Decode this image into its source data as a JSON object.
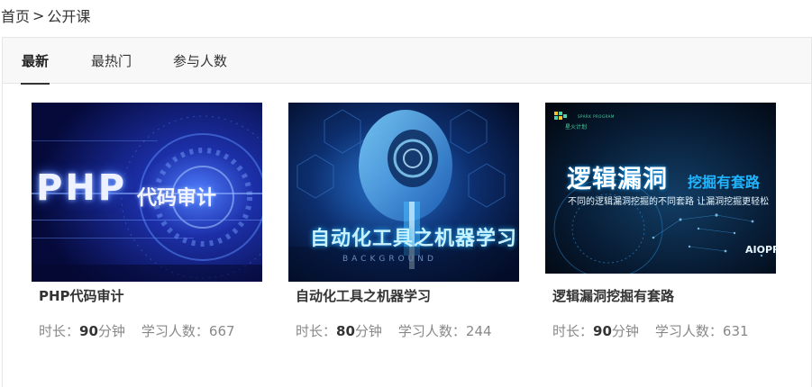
{
  "breadcrumb": {
    "home": "首页",
    "separator": ">",
    "current": "公开课"
  },
  "tabs": [
    {
      "label": "最新",
      "active": true
    },
    {
      "label": "最热门",
      "active": false
    },
    {
      "label": "参与人数",
      "active": false
    }
  ],
  "meta_labels": {
    "duration_prefix": "时长：",
    "duration_unit": "分钟",
    "learners_prefix": "学习人数："
  },
  "courses": [
    {
      "title": "PHP代码审计",
      "duration": "90",
      "learners": "667",
      "thumb": {
        "php": "PHP",
        "cn": "代码审计"
      }
    },
    {
      "title": "自动化工具之机器学习",
      "duration": "80",
      "learners": "244",
      "thumb": {
        "cn": "自动化工具之机器学习",
        "sub": "BACKGROUND"
      }
    },
    {
      "title": "逻辑漏洞挖掘有套路",
      "duration": "90",
      "learners": "631",
      "thumb": {
        "logo_sub": "SPARK PROGRAM",
        "logo_name": "星火计划",
        "main": "逻辑漏洞",
        "secondary": "挖掘有套路",
        "line": "不同的逻辑漏洞挖掘的不同套路  让漏洞挖掘更轻松",
        "corner": "AIOPR"
      }
    }
  ],
  "colors": {
    "tab_active_underline": "#333333",
    "tabbar_bg": "#f8f8f8",
    "meta_gray": "#888888"
  }
}
